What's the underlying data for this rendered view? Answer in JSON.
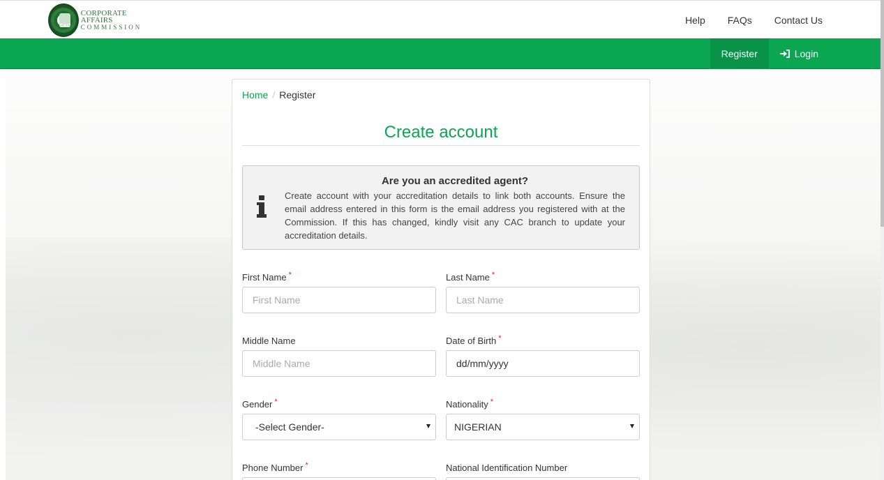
{
  "header": {
    "logo_line1": "CORPORATE AFFAIRS",
    "logo_line2": "COMMISSION",
    "seal_text": "CAC",
    "nav": [
      "Help",
      "FAQs",
      "Contact Us"
    ]
  },
  "greenbar": {
    "register": "Register",
    "login": "Login"
  },
  "breadcrumb": {
    "home": "Home",
    "separator": "/",
    "current": "Register"
  },
  "page_title": "Create account",
  "alert": {
    "icon": "info-icon",
    "title": "Are you an accredited agent?",
    "body": "Create account with your accreditation details to link both accounts. Ensure the email address entered in this form is the email address you registered with at the Commission. If this has changed, kindly visit any CAC branch to update your accreditation details."
  },
  "form": {
    "first_name": {
      "label": "First Name",
      "required": "*",
      "placeholder": "First Name"
    },
    "last_name": {
      "label": "Last Name",
      "required": "*",
      "placeholder": "Last Name"
    },
    "middle_name": {
      "label": "Middle Name",
      "placeholder": "Middle Name"
    },
    "dob": {
      "label": "Date of Birth",
      "required": "*",
      "value": "dd/mm/yyyy"
    },
    "gender": {
      "label": "Gender",
      "required": "*",
      "value": "-Select Gender-"
    },
    "nationality": {
      "label": "Nationality",
      "required": "*",
      "value": "NIGERIAN"
    },
    "phone": {
      "label": "Phone Number",
      "required": "*"
    },
    "nin": {
      "label": "National Identification Number"
    }
  },
  "colors": {
    "brand_green": "#0ba651",
    "required_red": "#e02020"
  }
}
